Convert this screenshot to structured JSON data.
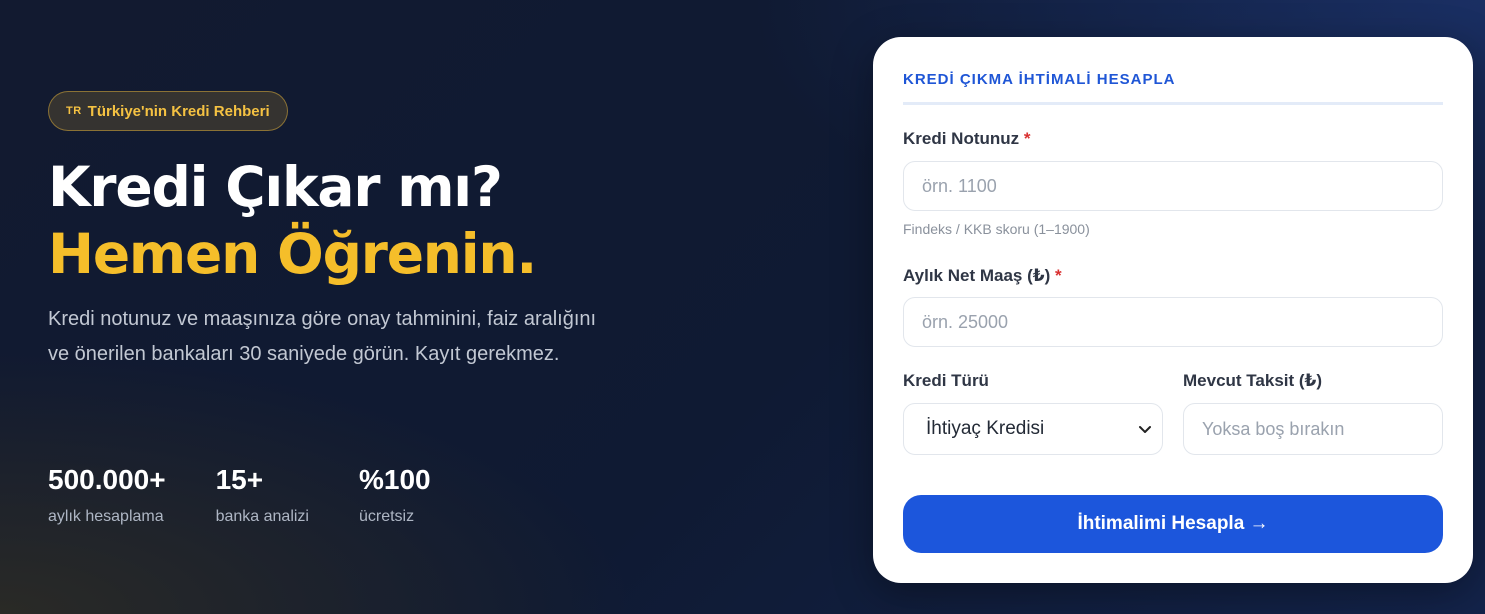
{
  "hero": {
    "badge_flag": "TR",
    "badge_text": "Türkiye'nin Kredi Rehberi",
    "title_line1": "Kredi Çıkar mı?",
    "title_line2": "Hemen Öğrenin.",
    "lead": "Kredi notunuz ve maaşınıza göre onay tahminini, faiz aralığını ve önerilen bankaları 30 saniyede görün. Kayıt gerekmez."
  },
  "stats": [
    {
      "value": "500.000+",
      "label": "aylık hesaplama"
    },
    {
      "value": "15+",
      "label": "banka analizi"
    },
    {
      "value": "%100",
      "label": "ücretsiz"
    }
  ],
  "form": {
    "title": "KREDİ ÇIKMA İHTİMALİ HESAPLA",
    "required_mark": "*",
    "credit_score": {
      "label": "Kredi Notunuz",
      "placeholder": "örn. 1100",
      "hint": "Findeks / KKB skoru (1–1900)"
    },
    "salary": {
      "label": "Aylık Net Maaş (₺)",
      "placeholder": "örn. 25000"
    },
    "loan_type": {
      "label": "Kredi Türü",
      "selected": "İhtiyaç Kredisi"
    },
    "installment": {
      "label": "Mevcut Taksit (₺)",
      "placeholder": "Yoksa boş bırakın"
    },
    "submit_label": "İhtimalimi Hesapla →"
  },
  "colors": {
    "accent": "#1c56dc",
    "highlight": "#f5be2a",
    "required": "#d93030"
  }
}
